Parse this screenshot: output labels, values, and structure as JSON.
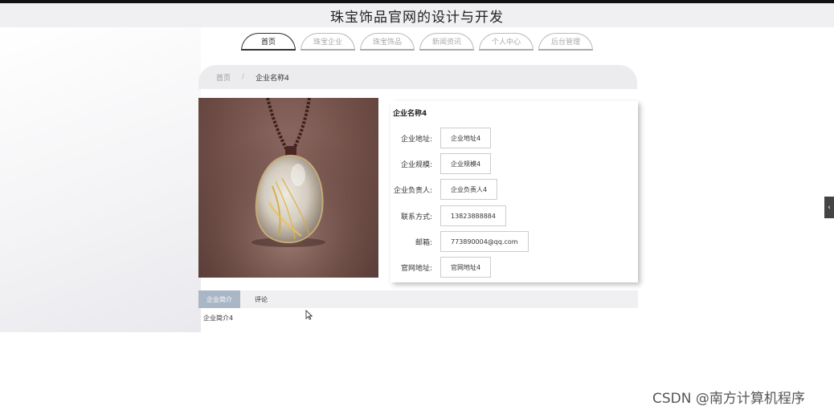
{
  "site": {
    "title": "珠宝饰品官网的设计与开发"
  },
  "nav": {
    "items": [
      {
        "label": "首页"
      },
      {
        "label": "珠宝企业"
      },
      {
        "label": "珠宝饰品"
      },
      {
        "label": "新闻资讯"
      },
      {
        "label": "个人中心"
      },
      {
        "label": "后台管理"
      }
    ],
    "active_index": 0
  },
  "breadcrumb": {
    "home": "首页",
    "separator": "/",
    "current": "企业名称4"
  },
  "company": {
    "name": "企业名称4",
    "fields": [
      {
        "label": "企业地址:",
        "value": "企业地址4"
      },
      {
        "label": "企业规模:",
        "value": "企业规模4"
      },
      {
        "label": "企业负责人:",
        "value": "企业负责人4"
      },
      {
        "label": "联系方式:",
        "value": "13823888884"
      },
      {
        "label": "邮箱:",
        "value": "773890004@qq.com"
      },
      {
        "label": "官网地址:",
        "value": "官网地址4"
      }
    ]
  },
  "tabs": {
    "items": [
      {
        "label": "企业简介"
      },
      {
        "label": "评论"
      }
    ],
    "active_index": 0,
    "content": "企业简介4"
  },
  "side_toggle": {
    "icon": "chevron-left-icon",
    "glyph": "‹"
  },
  "watermark": "CSDN @南方计算机程序",
  "colors": {
    "active_tab": "#a9b6c6",
    "header_bg": "#f0f0f2"
  }
}
